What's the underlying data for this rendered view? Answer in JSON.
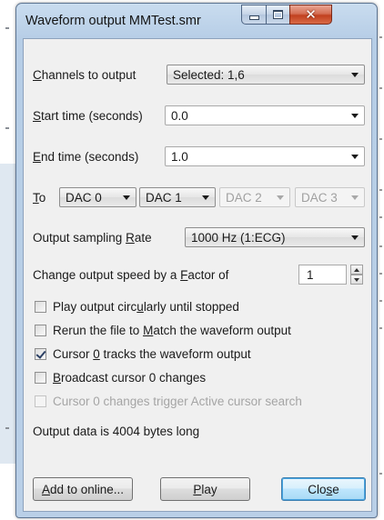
{
  "window": {
    "title": "Waveform output MMTest.smr",
    "close_glyph": "✕"
  },
  "channels": {
    "label_pre": "",
    "label_key": "C",
    "label_post": "hannels to output",
    "value": "Selected: 1,6"
  },
  "start_time": {
    "label_key": "S",
    "label_post": "tart time (seconds)",
    "value": "0.0"
  },
  "end_time": {
    "label_key": "E",
    "label_post": "nd time (seconds)",
    "value": "1.0"
  },
  "to": {
    "label_key": "T",
    "label_post": "o",
    "dacs": [
      "DAC 0",
      "DAC 1",
      "DAC 2",
      "DAC 3"
    ]
  },
  "rate": {
    "label_pre": "Output sampling ",
    "label_key": "R",
    "label_post": "ate",
    "value": "1000 Hz (1:ECG)"
  },
  "speed": {
    "label_pre": "Change output speed by a ",
    "label_key": "F",
    "label_post": "actor of",
    "value": "1"
  },
  "checks": [
    {
      "pre": "Play output circ",
      "key": "u",
      "post": "larly until stopped",
      "checked": false,
      "enabled": true
    },
    {
      "pre": "Rerun the file to ",
      "key": "M",
      "post": "atch the waveform output",
      "checked": false,
      "enabled": true
    },
    {
      "pre": "Cursor ",
      "key": "0",
      "post": " tracks the waveform output",
      "checked": true,
      "enabled": true
    },
    {
      "pre": "",
      "key": "B",
      "post": "roadcast cursor 0 changes",
      "checked": false,
      "enabled": true
    },
    {
      "pre": "Cursor 0 changes trigger Active cursor search",
      "key": "",
      "post": "",
      "checked": false,
      "enabled": false
    }
  ],
  "status": "Output data is 4004 bytes long",
  "buttons": {
    "add": {
      "key": "A",
      "post": "dd to online..."
    },
    "play": {
      "key": "P",
      "post": "lay"
    },
    "close": {
      "pre": "Clo",
      "key": "s",
      "post": "e"
    }
  }
}
